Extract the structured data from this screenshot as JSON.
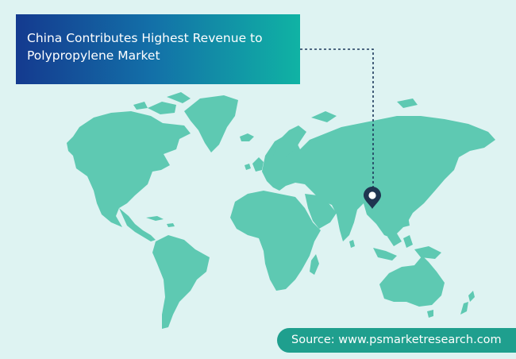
{
  "title_lines": [
    "China Contributes Highest Revenue to",
    "Polypropylene Market"
  ],
  "source": "Source: www.psmarketresearch.com",
  "highlighted_region": "China",
  "marker_icon": "location-pin-icon",
  "colors": {
    "background": "#def3f2",
    "land": "#5ec9b2",
    "title_gradient_start": "#143a8f",
    "title_gradient_end": "#10b3a4",
    "source_pill": "#1f9f8e",
    "connector": "#1e3a5c",
    "pin": "#1f3550"
  }
}
